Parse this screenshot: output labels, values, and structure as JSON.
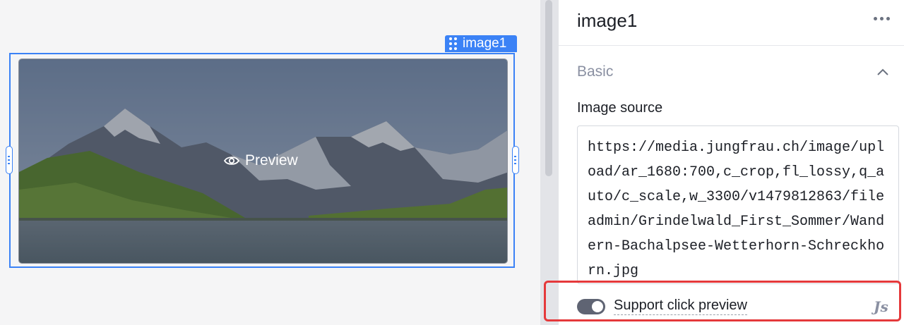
{
  "canvas": {
    "component_tag": "image1",
    "preview_label": "Preview"
  },
  "panel": {
    "title": "image1",
    "section_title": "Basic",
    "image_source_label": "Image source",
    "image_source_value": "https://media.jungfrau.ch/image/upload/ar_1680:700,c_crop,fl_lossy,q_auto/c_scale,w_3300/v1479812863/fileadmin/Grindelwald_First_Sommer/Wandern-Bachalpsee-Wetterhorn-Schreckhorn.jpg",
    "toggle_label": "Support click preview",
    "toggle_on": true,
    "js_badge": "Js"
  },
  "colors": {
    "accent": "#3b82f6",
    "highlight": "#e5393b"
  }
}
